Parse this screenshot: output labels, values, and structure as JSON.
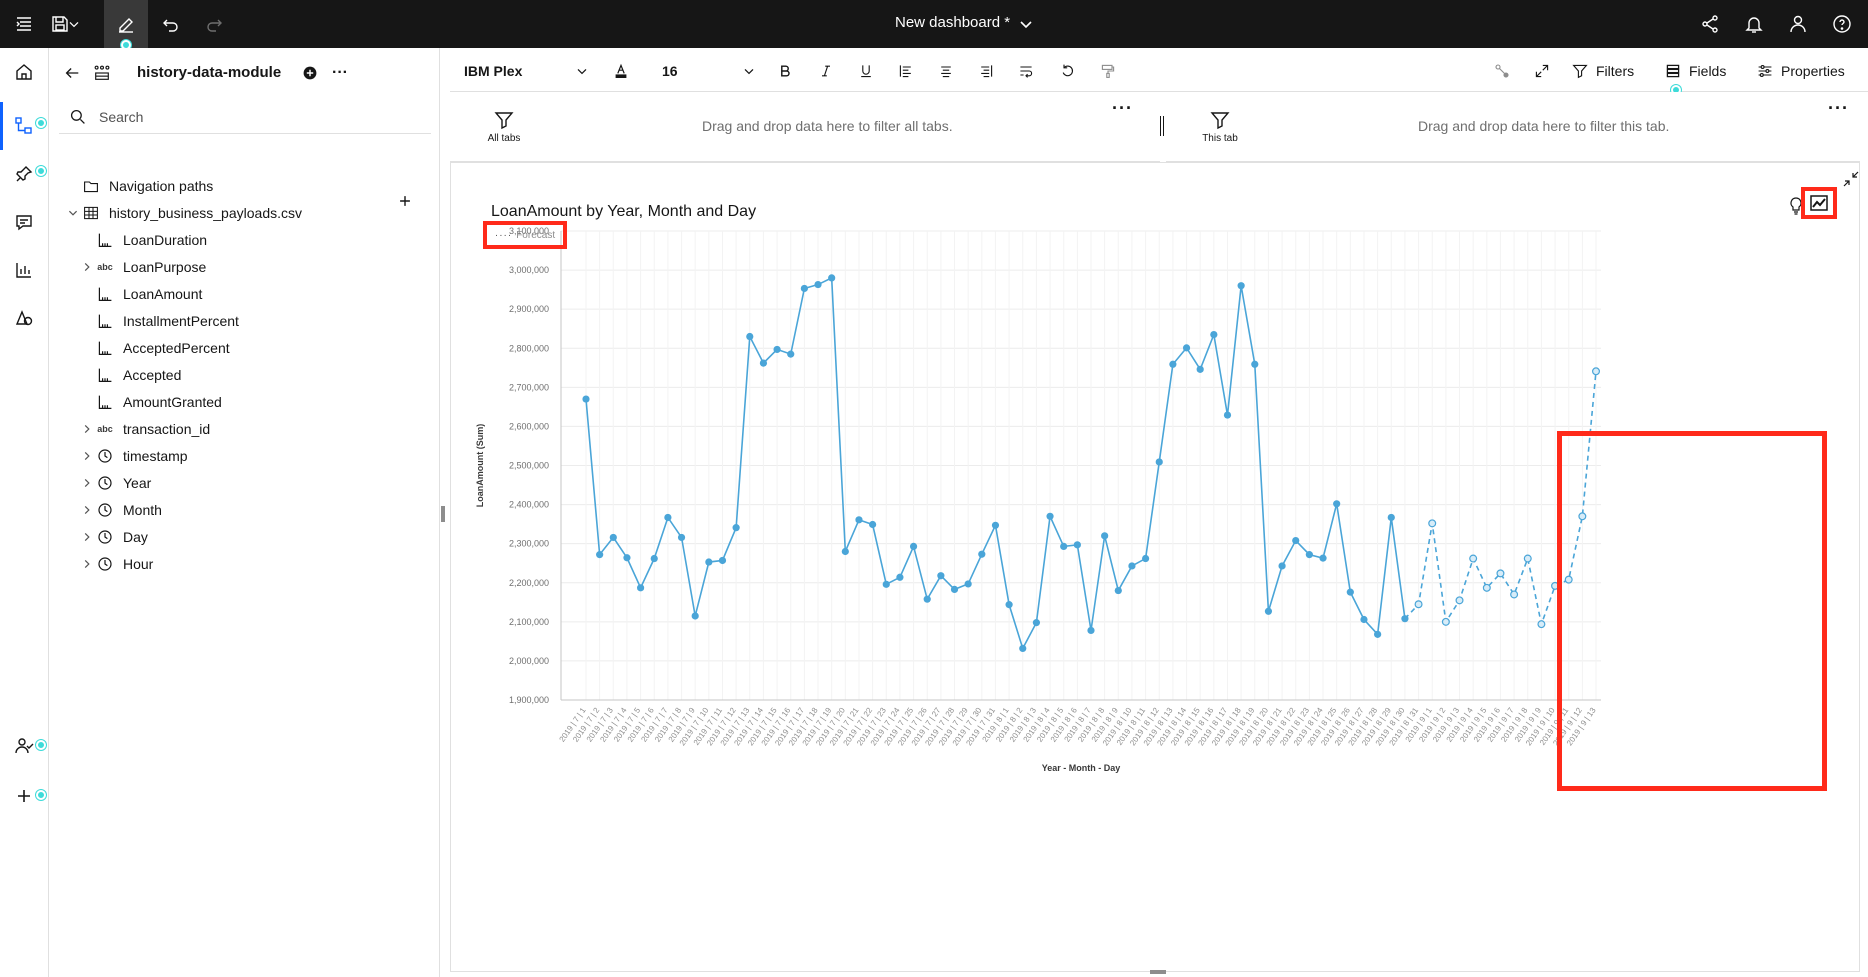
{
  "header": {
    "title": "New dashboard *"
  },
  "panel": {
    "module_name": "history-data-module",
    "search_placeholder": "Search",
    "tree": [
      {
        "label": "Navigation paths",
        "icon": "folder-icon",
        "level": 0,
        "expander": "none"
      },
      {
        "label": "history_business_payloads.csv",
        "icon": "table-icon",
        "level": 0,
        "expander": "expanded"
      },
      {
        "label": "LoanDuration",
        "icon": "measure-icon",
        "level": 1,
        "expander": "none"
      },
      {
        "label": "LoanPurpose",
        "icon": "text-icon",
        "level": 1,
        "expander": "collapsed"
      },
      {
        "label": "LoanAmount",
        "icon": "measure-icon",
        "level": 1,
        "expander": "none"
      },
      {
        "label": "InstallmentPercent",
        "icon": "measure-icon",
        "level": 1,
        "expander": "none"
      },
      {
        "label": "AcceptedPercent",
        "icon": "measure-icon",
        "level": 1,
        "expander": "none"
      },
      {
        "label": "Accepted",
        "icon": "measure-icon",
        "level": 1,
        "expander": "none"
      },
      {
        "label": "AmountGranted",
        "icon": "measure-icon",
        "level": 1,
        "expander": "none"
      },
      {
        "label": "transaction_id",
        "icon": "text-icon",
        "level": 1,
        "expander": "collapsed"
      },
      {
        "label": "timestamp",
        "icon": "clock-icon",
        "level": 1,
        "expander": "collapsed"
      },
      {
        "label": "Year",
        "icon": "clock-icon",
        "level": 1,
        "expander": "collapsed"
      },
      {
        "label": "Month",
        "icon": "clock-icon",
        "level": 1,
        "expander": "collapsed"
      },
      {
        "label": "Day",
        "icon": "clock-icon",
        "level": 1,
        "expander": "collapsed"
      },
      {
        "label": "Hour",
        "icon": "clock-icon",
        "level": 1,
        "expander": "collapsed"
      }
    ],
    "text_icon_label": "abc"
  },
  "toolbar": {
    "font_family": "IBM Plex",
    "font_size": "16",
    "filters_label": "Filters",
    "fields_label": "Fields",
    "properties_label": "Properties"
  },
  "filters": {
    "all_tabs_label": "All tabs",
    "all_tabs_hint": "Drag and drop data here to filter all tabs.",
    "this_tab_label": "This tab",
    "this_tab_hint": "Drag and drop data here to filter this tab."
  },
  "colors": {
    "series": "#4aa5d8",
    "highlight": "#ff2a1a",
    "topbar": "#161616",
    "accent": "#3ddbd9"
  },
  "chart_data": {
    "type": "line",
    "title": "LoanAmount by Year, Month and Day",
    "legend": "Forecast",
    "xlabel": "Year - Month - Day",
    "ylabel": "LoanAmount (Sum)",
    "ylim": [
      1900000,
      3100000
    ],
    "yticks": [
      1900000,
      2000000,
      2100000,
      2200000,
      2300000,
      2400000,
      2500000,
      2600000,
      2700000,
      2800000,
      2900000,
      3000000,
      3100000
    ],
    "ytick_labels": [
      "1,900,000",
      "2,000,000",
      "2,100,000",
      "2,200,000",
      "2,300,000",
      "2,400,000",
      "2,500,000",
      "2,600,000",
      "2,700,000",
      "2,800,000",
      "2,900,000",
      "3,000,000",
      "3,100,000"
    ],
    "grid": true,
    "categories": [
      "2019 | 7 | 1",
      "2019 | 7 | 2",
      "2019 | 7 | 3",
      "2019 | 7 | 4",
      "2019 | 7 | 5",
      "2019 | 7 | 6",
      "2019 | 7 | 7",
      "2019 | 7 | 8",
      "2019 | 7 | 9",
      "2019 | 7 | 10",
      "2019 | 7 | 11",
      "2019 | 7 | 12",
      "2019 | 7 | 13",
      "2019 | 7 | 14",
      "2019 | 7 | 15",
      "2019 | 7 | 16",
      "2019 | 7 | 17",
      "2019 | 7 | 18",
      "2019 | 7 | 19",
      "2019 | 7 | 20",
      "2019 | 7 | 21",
      "2019 | 7 | 22",
      "2019 | 7 | 23",
      "2019 | 7 | 24",
      "2019 | 7 | 25",
      "2019 | 7 | 26",
      "2019 | 7 | 27",
      "2019 | 7 | 28",
      "2019 | 7 | 29",
      "2019 | 7 | 30",
      "2019 | 7 | 31",
      "2019 | 8 | 1",
      "2019 | 8 | 2",
      "2019 | 8 | 3",
      "2019 | 8 | 4",
      "2019 | 8 | 5",
      "2019 | 8 | 6",
      "2019 | 8 | 7",
      "2019 | 8 | 8",
      "2019 | 8 | 9",
      "2019 | 8 | 10",
      "2019 | 8 | 11",
      "2019 | 8 | 12",
      "2019 | 8 | 13",
      "2019 | 8 | 14",
      "2019 | 8 | 15",
      "2019 | 8 | 16",
      "2019 | 8 | 17",
      "2019 | 8 | 18",
      "2019 | 8 | 19",
      "2019 | 8 | 20",
      "2019 | 8 | 21",
      "2019 | 8 | 22",
      "2019 | 8 | 23",
      "2019 | 8 | 24",
      "2019 | 8 | 25",
      "2019 | 8 | 26",
      "2019 | 8 | 27",
      "2019 | 8 | 28",
      "2019 | 8 | 29",
      "2019 | 8 | 30",
      "2019 | 8 | 31",
      "2019 | 9 | 1",
      "2019 | 9 | 2",
      "2019 | 9 | 3",
      "2019 | 9 | 4",
      "2019 | 9 | 5",
      "2019 | 9 | 6",
      "2019 | 9 | 7",
      "2019 | 9 | 8",
      "2019 | 9 | 9",
      "2019 | 9 | 10",
      "2019 | 9 | 11",
      "2019 | 9 | 12",
      "2019 | 9 | 13"
    ],
    "values": [
      2670000,
      2272000,
      2316000,
      2264000,
      2187000,
      2262000,
      2367000,
      2316000,
      2115000,
      2253000,
      2257000,
      2341000,
      2830000,
      2762000,
      2797000,
      2785000,
      2953000,
      2963000,
      2980000,
      2280000,
      2361000,
      2349000,
      2196000,
      2214000,
      2293000,
      2158000,
      2218000,
      2183000,
      2197000,
      2273000,
      2347000,
      2144000,
      2032000,
      2098000,
      2370000,
      2293000,
      2297000,
      2078000,
      2320000,
      2180000,
      2243000,
      2262000,
      2509000,
      2759000,
      2801000,
      2746000,
      2835000,
      2629000,
      2960000,
      2759000,
      2127000,
      2243000,
      2308000,
      2272000,
      2263000,
      2402000,
      2176000,
      2106000,
      2068000,
      2367000,
      2108000,
      2145000,
      2352000,
      2100000,
      2155000,
      2262000,
      2187000,
      2224000,
      2170000,
      2262000,
      2094000,
      2192000,
      2208000,
      2370000,
      2741000
    ],
    "forecast_start_index": 61
  }
}
